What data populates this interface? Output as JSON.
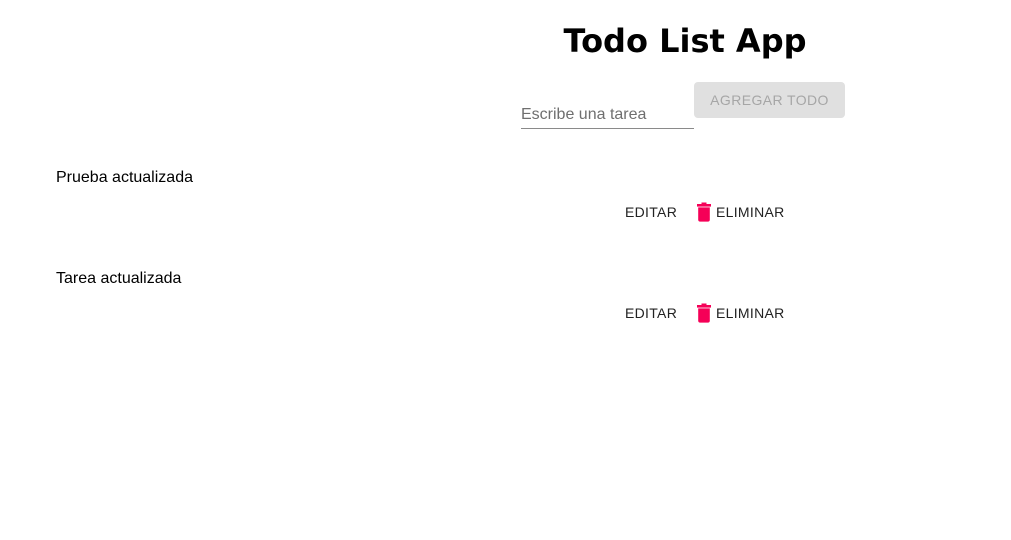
{
  "header": {
    "title": "Todo List App"
  },
  "form": {
    "input_placeholder": "Escribe una tarea",
    "input_value": "",
    "add_button_label": "AGREGAR TODO"
  },
  "todos": [
    {
      "text": "Prueba actualizada",
      "edit_label": "EDITAR",
      "delete_label": "ELIMINAR",
      "delete_icon": "trash-icon"
    },
    {
      "text": "Tarea actualizada",
      "edit_label": "EDITAR",
      "delete_label": "ELIMINAR",
      "delete_icon": "trash-icon"
    }
  ],
  "colors": {
    "delete_icon": "#f50057",
    "disabled_button_bg": "#e0e0e0",
    "disabled_button_text": "#a6a6a6"
  }
}
